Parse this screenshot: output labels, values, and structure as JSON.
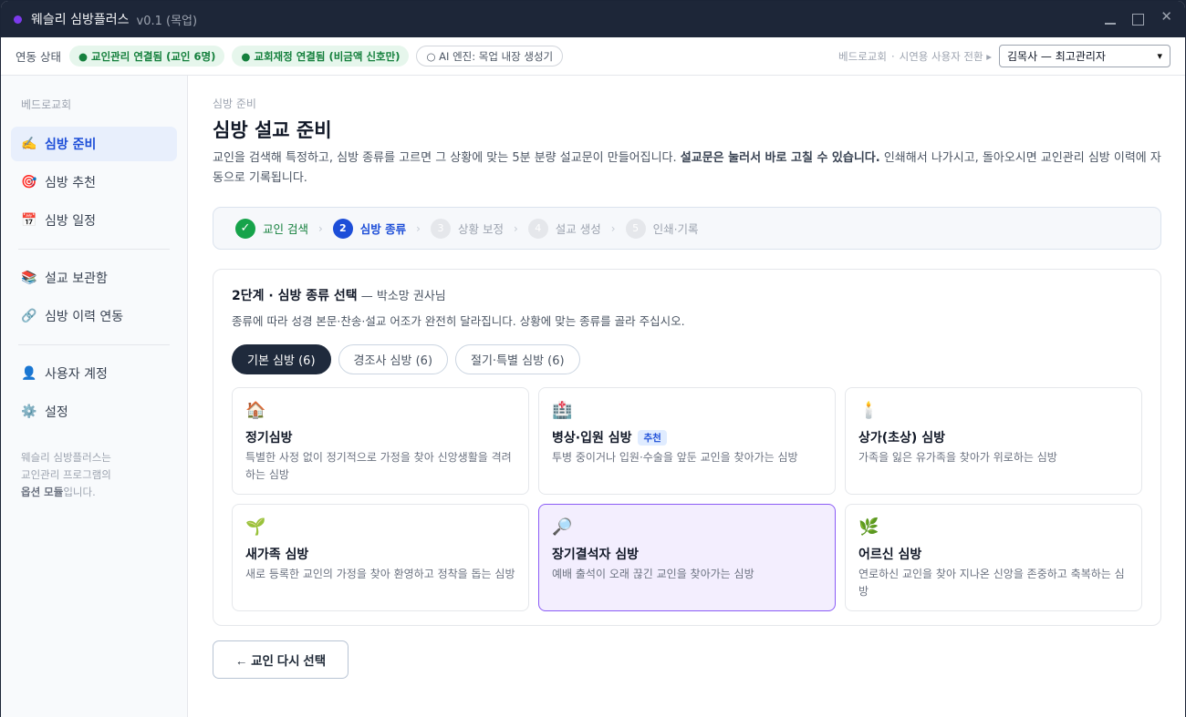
{
  "titlebar": {
    "app_name": "웨슬리 심방플러스",
    "version": "v0.1 (목업)"
  },
  "status": {
    "label": "연동 상태",
    "pills": [
      {
        "text": "● 교인관리 연결됨 (교인 6명)"
      },
      {
        "text": "● 교회재정 연결됨 (비금액 신호만)"
      },
      {
        "text": "○ AI 엔진: 목업 내장 생성기"
      }
    ],
    "church": "베드로교회",
    "sep": "·",
    "switch_label": "시연용 사용자 전환 ▸",
    "user_value": "김목사 — 최고관리자"
  },
  "sidebar": {
    "church": "베드로교회",
    "items": [
      {
        "icon": "✍️",
        "label": "심방 준비"
      },
      {
        "icon": "🎯",
        "label": "심방 추천"
      },
      {
        "icon": "📅",
        "label": "심방 일정"
      },
      {
        "icon": "📚",
        "label": "설교 보관함"
      },
      {
        "icon": "🔗",
        "label": "심방 이력 연동"
      },
      {
        "icon": "👤",
        "label": "사용자 계정"
      },
      {
        "icon": "⚙️",
        "label": "설정"
      }
    ],
    "note_line1": "웨슬리 심방플러스는",
    "note_line2": "교인관리 프로그램의",
    "note_bold": "옵션 모듈",
    "note_tail": "입니다."
  },
  "main": {
    "crumb": "심방 준비",
    "title": "심방 설교 준비",
    "desc_a": "교인을 검색해 특정하고, 심방 종류를 고르면 그 상황에 맞는 5분 분량 설교문이 만들어집니다. ",
    "desc_bold": "설교문은 눌러서 바로 고칠 수 있습니다.",
    "desc_b": " 인쇄해서 나가시고, 돌아오시면 교인관리 심방 이력에 자동으로 기록됩니다."
  },
  "stepper": {
    "steps": [
      {
        "num": "✓",
        "label": "교인 검색"
      },
      {
        "num": "2",
        "label": "심방 종류"
      },
      {
        "num": "3",
        "label": "상황 보정"
      },
      {
        "num": "4",
        "label": "설교 생성"
      },
      {
        "num": "5",
        "label": "인쇄·기록"
      }
    ],
    "sep": "›"
  },
  "panel": {
    "title_bold": "2단계 · 심방 종류 선택",
    "title_who": " — 박소망 권사님",
    "desc": "종류에 따라 성경 본문·찬송·설교 어조가 완전히 달라집니다. 상황에 맞는 종류를 골라 주십시오.",
    "tabs": [
      {
        "label": "기본 심방 (6)"
      },
      {
        "label": "경조사 심방 (6)"
      },
      {
        "label": "절기·특별 심방 (6)"
      }
    ],
    "cards": [
      {
        "icon": "🏠",
        "title": "정기심방",
        "desc": "특별한 사정 없이 정기적으로 가정을 찾아 신앙생활을 격려하는 심방"
      },
      {
        "icon": "🏥",
        "title": "병상·입원 심방",
        "badge": "추천",
        "desc": "투병 중이거나 입원·수술을 앞둔 교인을 찾아가는 심방"
      },
      {
        "icon": "🕯️",
        "title": "상가(초상) 심방",
        "desc": "가족을 잃은 유가족을 찾아가 위로하는 심방"
      },
      {
        "icon": "🌱",
        "title": "새가족 심방",
        "desc": "새로 등록한 교인의 가정을 찾아 환영하고 정착을 돕는 심방"
      },
      {
        "icon": "🔎",
        "title": "장기결석자 심방",
        "desc": "예배 출석이 오래 끊긴 교인을 찾아가는 심방"
      },
      {
        "icon": "🌿",
        "title": "어르신 심방",
        "desc": "연로하신 교인을 찾아 지나온 신앙을 존중하고 축복하는 심방"
      }
    ]
  },
  "back_button": "← 교인 다시 선택"
}
